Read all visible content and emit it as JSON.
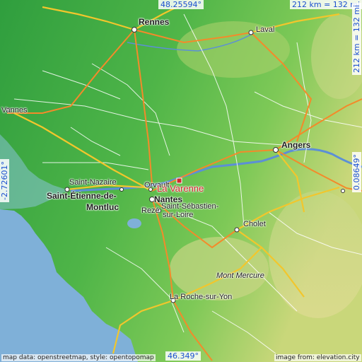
{
  "place": {
    "name": "La Varenne"
  },
  "coords": {
    "top_lat": "48.25594°",
    "bottom_lat": "46.349°",
    "left_lon": "-2.72601°",
    "right_lon": "0.08649°",
    "scale_top": "212 km = 132 mi",
    "scale_right": "212 km = 132 mi"
  },
  "cities": [
    {
      "id": "rennes",
      "name": "Rennes"
    },
    {
      "id": "laval",
      "name": "Laval"
    },
    {
      "id": "vannes",
      "name": "Vannes"
    },
    {
      "id": "angers",
      "name": "Angers"
    },
    {
      "id": "saint-nazaire",
      "name": "Saint-Nazaire"
    },
    {
      "id": "saint-etienne-1",
      "name": "Saint-Étienne-de-"
    },
    {
      "id": "saint-etienne-2",
      "name": "Montluc"
    },
    {
      "id": "orvault",
      "name": "Orvault"
    },
    {
      "id": "nantes",
      "name": "Nantes"
    },
    {
      "id": "reze",
      "name": "Rezé"
    },
    {
      "id": "saint-sebastien-1",
      "name": "Saint-Sébastien-"
    },
    {
      "id": "saint-sebastien-2",
      "name": "sur-Loire"
    },
    {
      "id": "cholet",
      "name": "Cholet"
    },
    {
      "id": "mont-mercure",
      "name": "Mont Mercure"
    },
    {
      "id": "la-roche",
      "name": "La Roche-sur-Yon"
    }
  ],
  "attribution": {
    "left": "map data: openstreetmap, style: opentopomap",
    "right": "image from: elevation.city"
  },
  "colors": {
    "sea": "#7fb0d8",
    "land_low": "#2f9e3e",
    "land_mid": "#5fbf4a",
    "land_high": "#d7dc8a",
    "road_major": "#f2c62c",
    "road_primary": "#f48a2a",
    "marker": "#d3262b"
  }
}
